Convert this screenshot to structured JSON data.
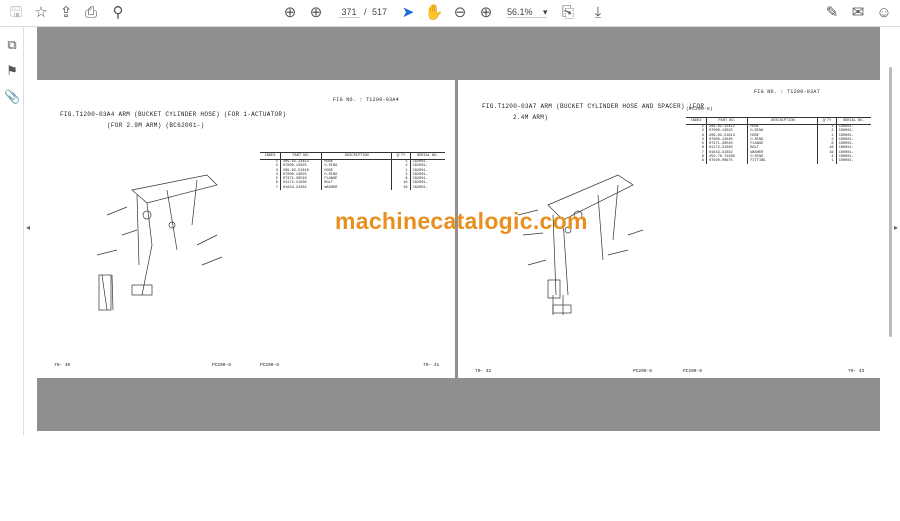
{
  "toolbar": {
    "current_page": "371",
    "page_separator": "/",
    "total_pages": "517",
    "zoom": "56.1%"
  },
  "watermark": "machinecatalogic.com",
  "pages": [
    {
      "fig_no": "FIG NO. : T1200-03A4",
      "title": "FIG.T1200-03A4  ARM (BUCKET CYLINDER HOSE) (FOR 1-ACTUATOR)",
      "subtitle": "(FOR 2.9M ARM) (BC62001-)",
      "model_label": "",
      "headers": [
        "INDEX",
        "PART NO.",
        "DESCRIPTION",
        "Q'TY",
        "SERIAL NO."
      ],
      "rows": [
        [
          "1",
          "209-62-13412",
          "HOSE",
          "1",
          "C62001-"
        ],
        [
          "2",
          "07000-13025",
          "O-RING",
          "2",
          "C62001-"
        ],
        [
          "3",
          "209-62-51810",
          "HOSE",
          "1",
          "C62001-"
        ],
        [
          "4",
          "07000-13025",
          "O-RING",
          "2",
          "C62001-"
        ],
        [
          "5",
          "07371-30540",
          "FLANGE",
          "8",
          "C62001-"
        ],
        [
          "6",
          "01172-21030",
          "BOLT",
          "16",
          "C62001-"
        ],
        [
          "7",
          "01643-31032",
          "WASHER",
          "16",
          "C62001-"
        ]
      ],
      "footer_left": "70- 40",
      "footer_left_model": "PC200-8",
      "footer_right_model": "PC200-8",
      "footer_right": "70- 41"
    },
    {
      "fig_no": "FIG NO. : T1200-03A7",
      "title": "FIG.T1200-03A7  ARM (BUCKET CYLINDER HOSE AND SPACER) (FOR",
      "subtitle": "2.4M ARM)",
      "model_label": "(PC200-8)",
      "headers": [
        "INDEX",
        "PART NO.",
        "DESCRIPTION",
        "Q'TY",
        "SERIAL NO."
      ],
      "rows": [
        [
          "1",
          "209-62-13412",
          "HOSE",
          "1",
          "C60001-"
        ],
        [
          "2",
          "07000-13025",
          "O-RING",
          "2",
          "C60001-"
        ],
        [
          "3",
          "209-62-51813",
          "HOSE",
          "1",
          "C60001-"
        ],
        [
          "4",
          "07000-13025",
          "O-RING",
          "2",
          "C60001-"
        ],
        [
          "5",
          "07371-30540",
          "FLANGE",
          "8",
          "C60001-"
        ],
        [
          "6",
          "01172-21030",
          "BOLT",
          "16",
          "C60001-"
        ],
        [
          "7",
          "01643-31032",
          "WASHER",
          "16",
          "C60001-"
        ],
        [
          "8",
          "250-70-72260",
          "O-RING",
          "4",
          "C60001-"
        ],
        [
          "9",
          "07020-00675",
          "FITTING",
          "1",
          "C60001-"
        ]
      ],
      "footer_left": "70- 42",
      "footer_left_model": "PC200-8",
      "footer_right_model": "PC200-8",
      "footer_right": "70- 43"
    }
  ]
}
